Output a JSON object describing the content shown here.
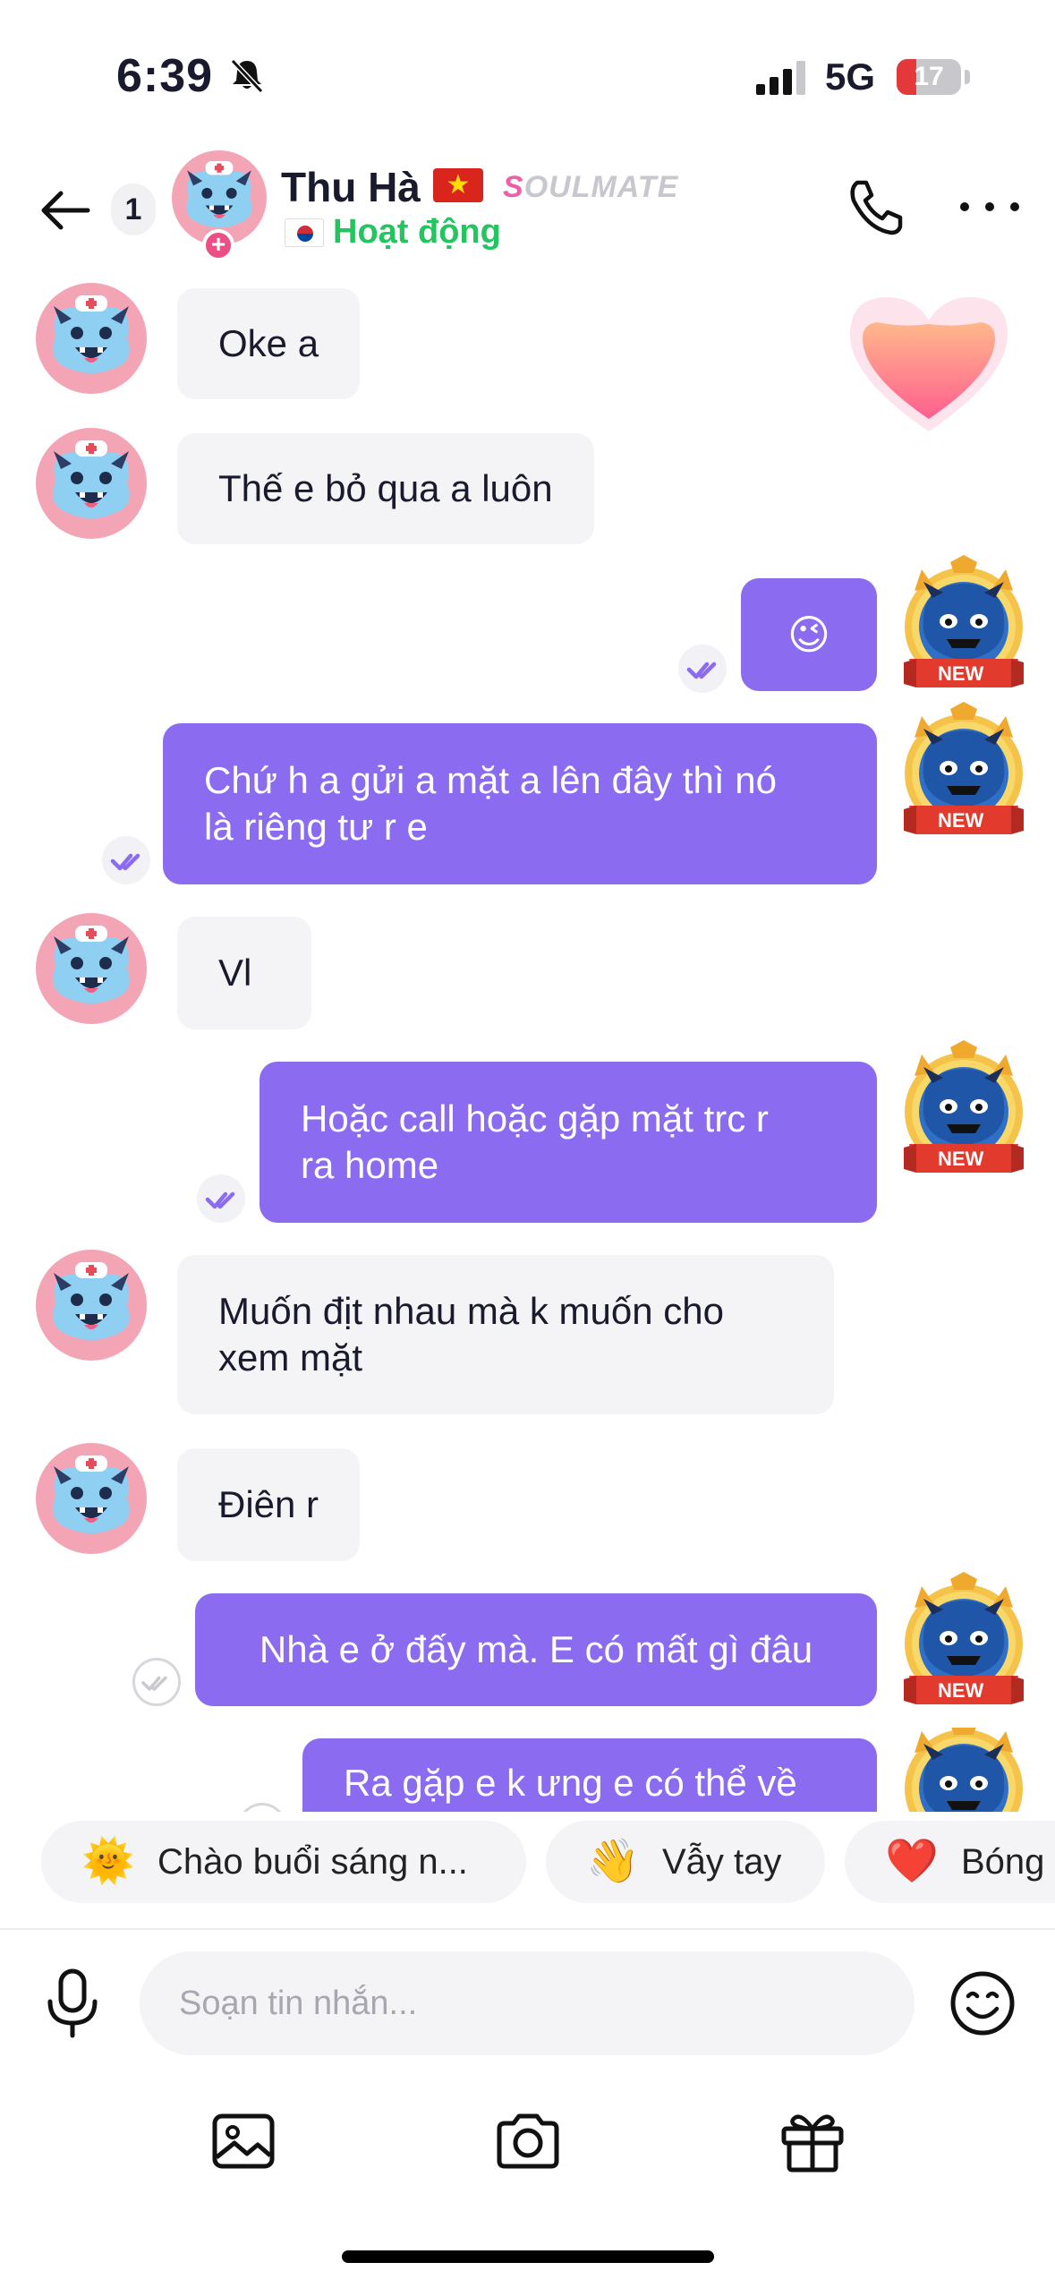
{
  "status_bar": {
    "time": "6:39",
    "network": "5G",
    "battery": "17"
  },
  "header": {
    "unread_count": "1",
    "contact_name": "Thu Hà",
    "badge_initial": "S",
    "badge_rest": "OULMATE",
    "status": "Hoạt động",
    "icons": [
      "back-arrow-icon",
      "phone-icon",
      "more-icon"
    ]
  },
  "messages": [
    {
      "side": "in",
      "text": "Oke a"
    },
    {
      "side": "in",
      "text": "Thế e bỏ qua a luôn"
    },
    {
      "side": "out",
      "text": "😉",
      "read": true
    },
    {
      "side": "out",
      "line1": "Chứ h a gửi a mặt a lên đây thì nó",
      "line2": "là riêng tư r e",
      "read": true
    },
    {
      "side": "in",
      "text": "Vl"
    },
    {
      "side": "out",
      "line1": "Hoặc call hoặc gặp mặt trc r",
      "line2": "ra home",
      "read": true
    },
    {
      "side": "in",
      "line1": "Muốn địt nhau mà k muốn cho",
      "line2": "xem mặt"
    },
    {
      "side": "in",
      "text": "Điên r"
    },
    {
      "side": "out",
      "text": "Nhà e ở đấy mà. E có mất gì đâu",
      "read": false
    },
    {
      "side": "out",
      "text": "Ra gặp e k ưng e có thể về",
      "read": false
    }
  ],
  "my_avatar_badge": "NEW",
  "quick_replies": [
    {
      "icon": "🌞",
      "label": "Chào buổi sáng n..."
    },
    {
      "icon": "👋",
      "label": "Vẫy tay"
    },
    {
      "icon": "❤️",
      "label": "Bóng"
    }
  ],
  "composer": {
    "placeholder": "Soạn tin nhắn..."
  },
  "colors": {
    "accent": "#8b6cf0",
    "incoming_bubble": "#f4f4f7",
    "online": "#22c55e"
  }
}
